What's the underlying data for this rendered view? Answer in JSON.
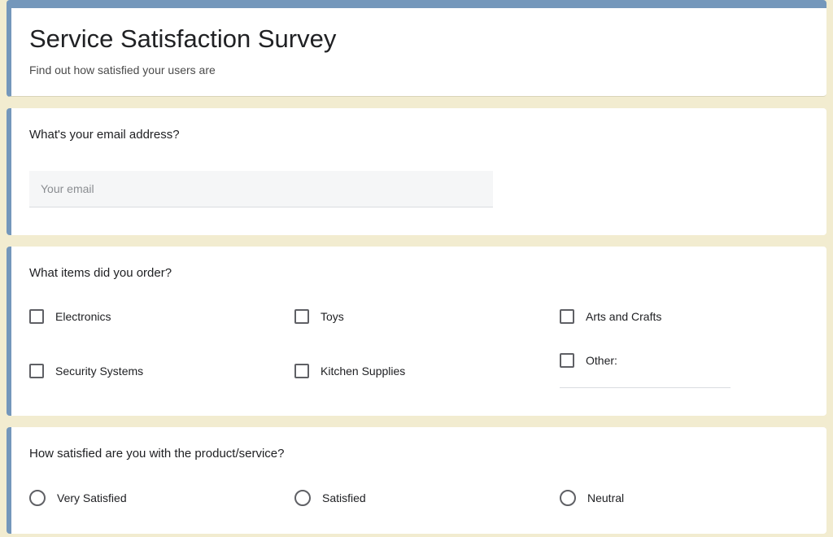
{
  "header": {
    "title": "Service Satisfaction Survey",
    "subtitle": "Find out how satisfied your users are"
  },
  "questions": [
    {
      "title": "What's your email address?",
      "email_placeholder": "Your email"
    },
    {
      "title": "What items did you order?",
      "options": [
        "Electronics",
        "Toys",
        "Arts and Crafts",
        "Security Systems",
        "Kitchen Supplies",
        "Other:"
      ]
    },
    {
      "title": "How satisfied are you with the product/service?",
      "options": [
        "Very Satisfied",
        "Satisfied",
        "Neutral"
      ]
    }
  ]
}
